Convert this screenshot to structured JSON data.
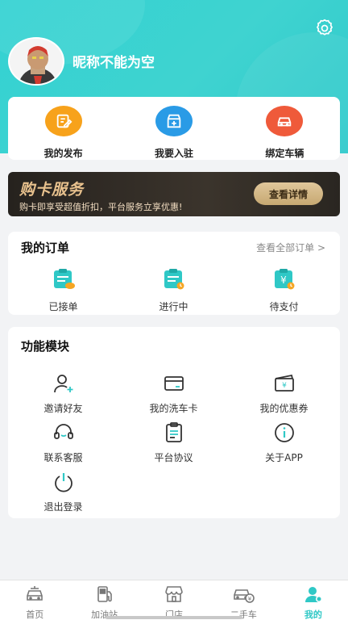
{
  "profile": {
    "nickname": "昵称不能为空"
  },
  "quick_actions": [
    {
      "label": "我的发布",
      "icon": "edit-icon",
      "color": "#f7a21b"
    },
    {
      "label": "我要入驻",
      "icon": "store-add-icon",
      "color": "#2a9be6"
    },
    {
      "label": "绑定车辆",
      "icon": "car-icon",
      "color": "#ef5a3a"
    }
  ],
  "banner": {
    "title": "购卡服务",
    "subtitle": "购卡即享受超值折扣，平台服务立享优惠!",
    "button": "查看详情"
  },
  "orders": {
    "title": "我的订单",
    "more": "查看全部订单 >",
    "items": [
      {
        "label": "已接单",
        "icon": "order-accepted-icon"
      },
      {
        "label": "进行中",
        "icon": "order-in-progress-icon"
      },
      {
        "label": "待支付",
        "icon": "order-pending-payment-icon"
      }
    ]
  },
  "modules": {
    "title": "功能模块",
    "items": [
      {
        "label": "邀请好友",
        "icon": "invite-friend-icon"
      },
      {
        "label": "我的洗车卡",
        "icon": "card-icon"
      },
      {
        "label": "我的优惠券",
        "icon": "coupon-icon"
      },
      {
        "label": "联系客服",
        "icon": "headset-icon"
      },
      {
        "label": "平台协议",
        "icon": "agreement-icon"
      },
      {
        "label": "关于APP",
        "icon": "info-icon"
      },
      {
        "label": "退出登录",
        "icon": "power-icon"
      }
    ]
  },
  "tabbar": {
    "active": "我的",
    "items": [
      {
        "label": "首页",
        "icon": "home-car-icon"
      },
      {
        "label": "加油站",
        "icon": "fuel-pump-icon"
      },
      {
        "label": "门店",
        "icon": "shop-icon"
      },
      {
        "label": "二手车",
        "icon": "used-car-icon"
      },
      {
        "label": "我的",
        "icon": "profile-icon"
      }
    ]
  },
  "colors": {
    "accent": "#2fc8c6",
    "header": "#3fd3d0",
    "banner_gold": "#e9c28e"
  }
}
